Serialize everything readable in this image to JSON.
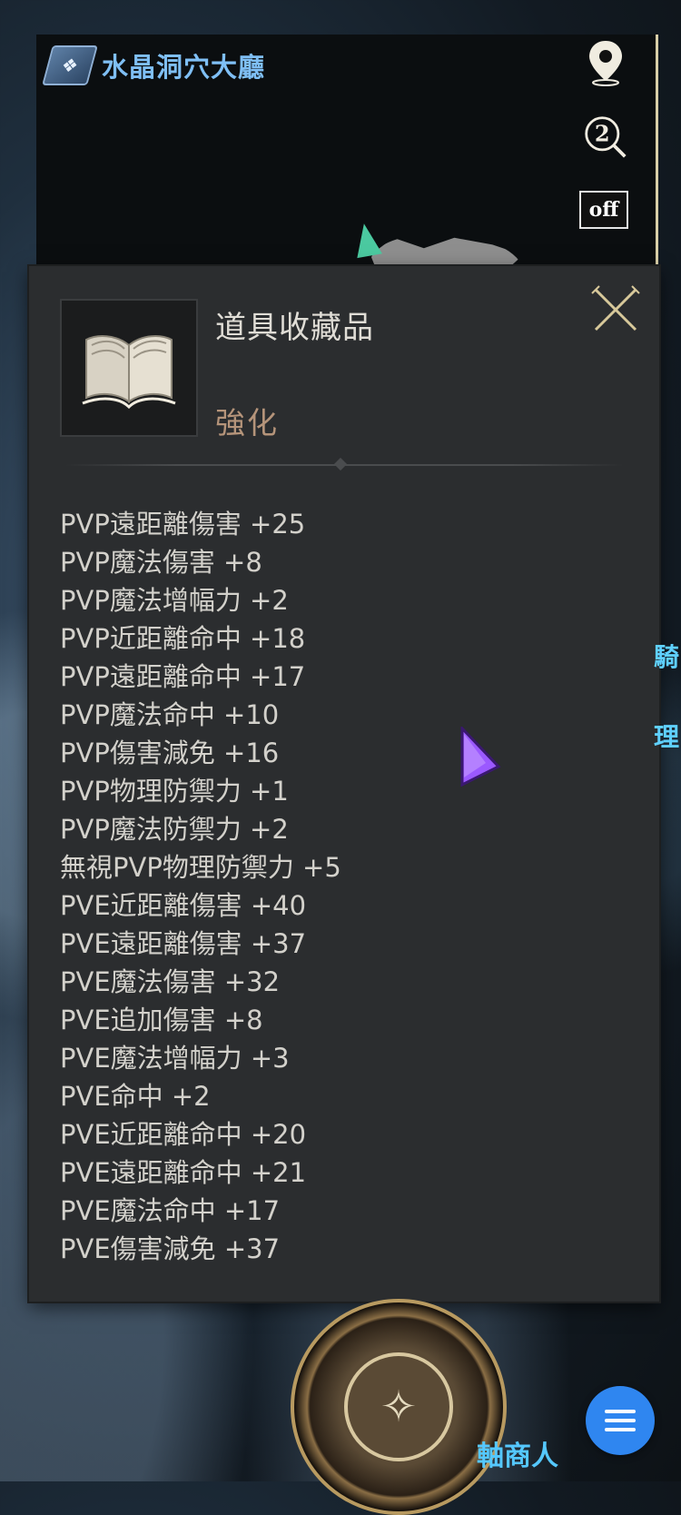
{
  "map": {
    "location_name": "水晶洞穴大廳",
    "toggle_label": "off",
    "help_label": "2"
  },
  "panel": {
    "title": "道具收藏品",
    "subtitle": "強化",
    "stats": [
      "PVP遠距離傷害 +25",
      "PVP魔法傷害 +8",
      "PVP魔法增幅力 +2",
      "PVP近距離命中 +18",
      "PVP遠距離命中 +17",
      "PVP魔法命中 +10",
      "PVP傷害減免 +16",
      "PVP物理防禦力 +1",
      "PVP魔法防禦力 +2",
      "無視PVP物理防禦力 +5",
      "PVE近距離傷害 +40",
      "PVE遠距離傷害 +37",
      "PVE魔法傷害 +32",
      "PVE追加傷害 +8",
      "PVE魔法增幅力 +3",
      "PVE命中 +2",
      "PVE近距離命中 +20",
      "PVE遠距離命中 +21",
      "PVE魔法命中 +17",
      "PVE傷害減免 +37"
    ]
  },
  "hud": {
    "merchant_label": "軸商人",
    "right_label_1": "騎",
    "right_label_2": "理"
  },
  "colors": {
    "location": "#7fbff5",
    "subtitle": "#b5947a",
    "menu_button": "#2f86f0"
  },
  "icons": [
    "location-pin-icon",
    "help-zoom-icon",
    "close-icon",
    "book-icon",
    "compass-icon",
    "hamburger-menu-icon",
    "cursor-pointer-icon"
  ]
}
